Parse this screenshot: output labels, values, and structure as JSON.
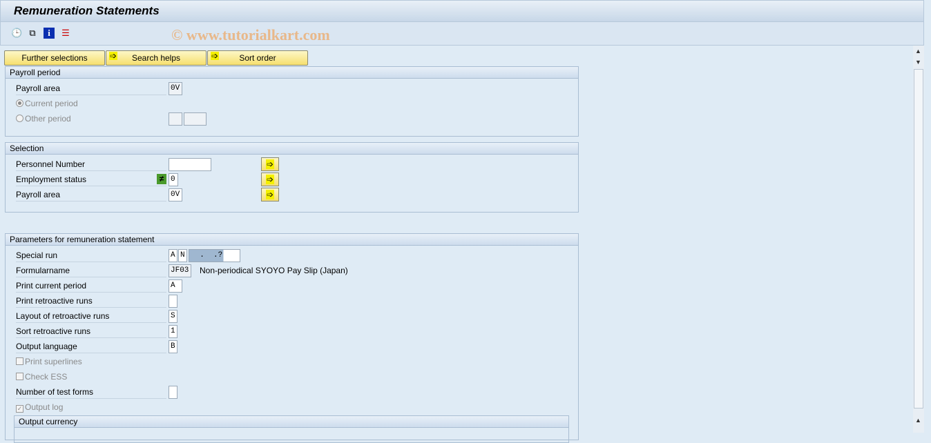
{
  "title": "Remuneration Statements",
  "toolbar": {
    "icons": [
      "execute-clock-icon",
      "variants-icon",
      "info-icon",
      "layout-icon"
    ]
  },
  "watermark": "© www.tutorialkart.com",
  "buttons": {
    "further": "Further selections",
    "search": "Search helps",
    "sort": "Sort order"
  },
  "payroll_period": {
    "header": "Payroll period",
    "payroll_area_label": "Payroll area",
    "payroll_area_value": "0V",
    "current_period": "Current period",
    "other_period": "Other period"
  },
  "selection": {
    "header": "Selection",
    "personnel_number": "Personnel Number",
    "employment_status": "Employment status",
    "employment_status_value": "0",
    "payroll_area": "Payroll area",
    "payroll_area_value": "0V"
  },
  "params": {
    "header": "Parameters for remuneration statement",
    "special_run": "Special run",
    "special_run_a": "A",
    "special_run_n": "N",
    "special_run_date": "  .  .?",
    "formularname": "Formularname",
    "formularname_value": "JF03",
    "formularname_desc": "Non-periodical SYOYO Pay Slip (Japan)",
    "print_current": "Print current period",
    "print_current_value": "A",
    "print_retro": "Print retroactive runs",
    "layout_retro": "Layout of retroactive runs",
    "layout_retro_value": "S",
    "sort_retro": "Sort retroactive runs",
    "sort_retro_value": "1",
    "output_language": "Output language",
    "output_language_value": "B",
    "print_superlines": "Print superlines",
    "check_ess": "Check ESS",
    "test_forms": "Number of test forms",
    "output_log": "Output log",
    "output_log_checked": true,
    "output_currency": "Output currency"
  }
}
